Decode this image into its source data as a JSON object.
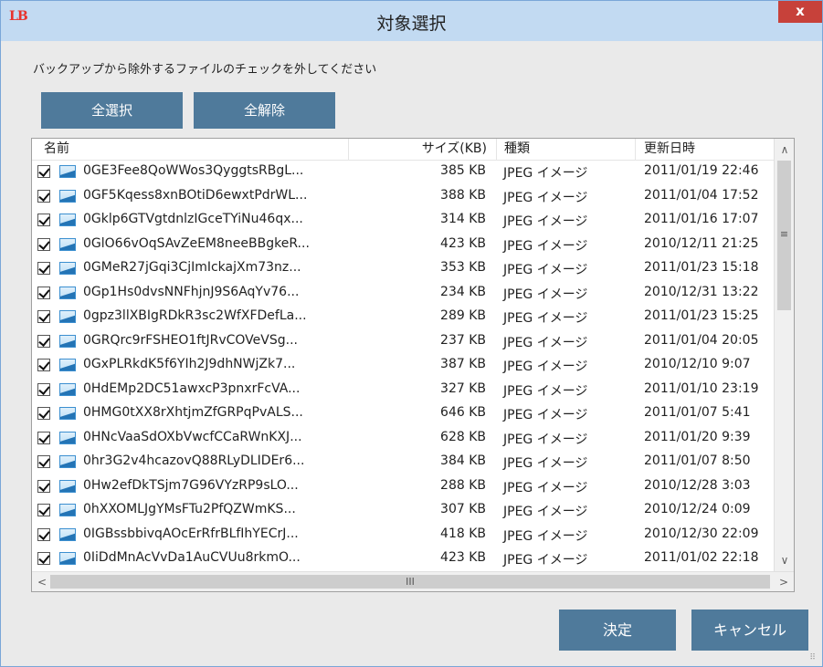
{
  "window": {
    "logo": "LB",
    "title": "対象選択",
    "close_label": "x"
  },
  "instruction": "バックアップから除外するファイルのチェックを外してください",
  "buttons": {
    "select_all": "全選択",
    "deselect_all": "全解除",
    "ok": "決定",
    "cancel": "キャンセル"
  },
  "table": {
    "columns": [
      "名前",
      "サイズ(KB)",
      "種類",
      "更新日時"
    ],
    "rows": [
      {
        "checked": true,
        "name": "0GE3Fee8QoWWos3QyggtsRBgL...",
        "size": "385 KB",
        "type": "JPEG イメージ",
        "date": "2011/01/19 22:46"
      },
      {
        "checked": true,
        "name": "0GF5Kqess8xnBOtiD6ewxtPdrWL...",
        "size": "388 KB",
        "type": "JPEG イメージ",
        "date": "2011/01/04 17:52"
      },
      {
        "checked": true,
        "name": "0Gklp6GTVgtdnlzIGceTYiNu46qx...",
        "size": "314 KB",
        "type": "JPEG イメージ",
        "date": "2011/01/16 17:07"
      },
      {
        "checked": true,
        "name": "0GlO66vOqSAvZeEM8neeBBgkeR...",
        "size": "423 KB",
        "type": "JPEG イメージ",
        "date": "2010/12/11 21:25"
      },
      {
        "checked": true,
        "name": "0GMeR27jGqi3CjImIckajXm73nz...",
        "size": "353 KB",
        "type": "JPEG イメージ",
        "date": "2011/01/23 15:18"
      },
      {
        "checked": true,
        "name": "0Gp1Hs0dvsNNFhjnJ9S6AqYv76...",
        "size": "234 KB",
        "type": "JPEG イメージ",
        "date": "2010/12/31 13:22"
      },
      {
        "checked": true,
        "name": "0gpz3llXBIgRDkR3sc2WfXFDefLa...",
        "size": "289 KB",
        "type": "JPEG イメージ",
        "date": "2011/01/23 15:25"
      },
      {
        "checked": true,
        "name": "0GRQrc9rFSHEO1ftJRvCOVeVSg...",
        "size": "237 KB",
        "type": "JPEG イメージ",
        "date": "2011/01/04 20:05"
      },
      {
        "checked": true,
        "name": "0GxPLRkdK5f6YIh2J9dhNWjZk7...",
        "size": "387 KB",
        "type": "JPEG イメージ",
        "date": "2010/12/10 9:07"
      },
      {
        "checked": true,
        "name": "0HdEMp2DC51awxcP3pnxrFcVA...",
        "size": "327 KB",
        "type": "JPEG イメージ",
        "date": "2011/01/10 23:19"
      },
      {
        "checked": true,
        "name": "0HMG0tXX8rXhtjmZfGRPqPvALS...",
        "size": "646 KB",
        "type": "JPEG イメージ",
        "date": "2011/01/07 5:41"
      },
      {
        "checked": true,
        "name": "0HNcVaaSdOXbVwcfCCaRWnKXJ...",
        "size": "628 KB",
        "type": "JPEG イメージ",
        "date": "2011/01/20 9:39"
      },
      {
        "checked": true,
        "name": "0hr3G2v4hcazovQ88RLyDLIDEr6...",
        "size": "384 KB",
        "type": "JPEG イメージ",
        "date": "2011/01/07 8:50"
      },
      {
        "checked": true,
        "name": "0Hw2efDkTSjm7G96VYzRP9sLO...",
        "size": "288 KB",
        "type": "JPEG イメージ",
        "date": "2010/12/28 3:03"
      },
      {
        "checked": true,
        "name": "0hXXOMLJgYMsFTu2PfQZWmKS...",
        "size": "307 KB",
        "type": "JPEG イメージ",
        "date": "2010/12/24 0:09"
      },
      {
        "checked": true,
        "name": "0IGBssbbivqAOcErRfrBLfIhYECrJ...",
        "size": "418 KB",
        "type": "JPEG イメージ",
        "date": "2010/12/30 22:09"
      },
      {
        "checked": true,
        "name": "0IiDdMnAcVvDa1AuCVUu8rkmO...",
        "size": "423 KB",
        "type": "JPEG イメージ",
        "date": "2011/01/02 22:18"
      }
    ]
  },
  "scrollbars": {
    "up": "∧",
    "down": "∨",
    "left": "<",
    "right": ">",
    "vgrip": "≡",
    "hgrip": "III"
  }
}
